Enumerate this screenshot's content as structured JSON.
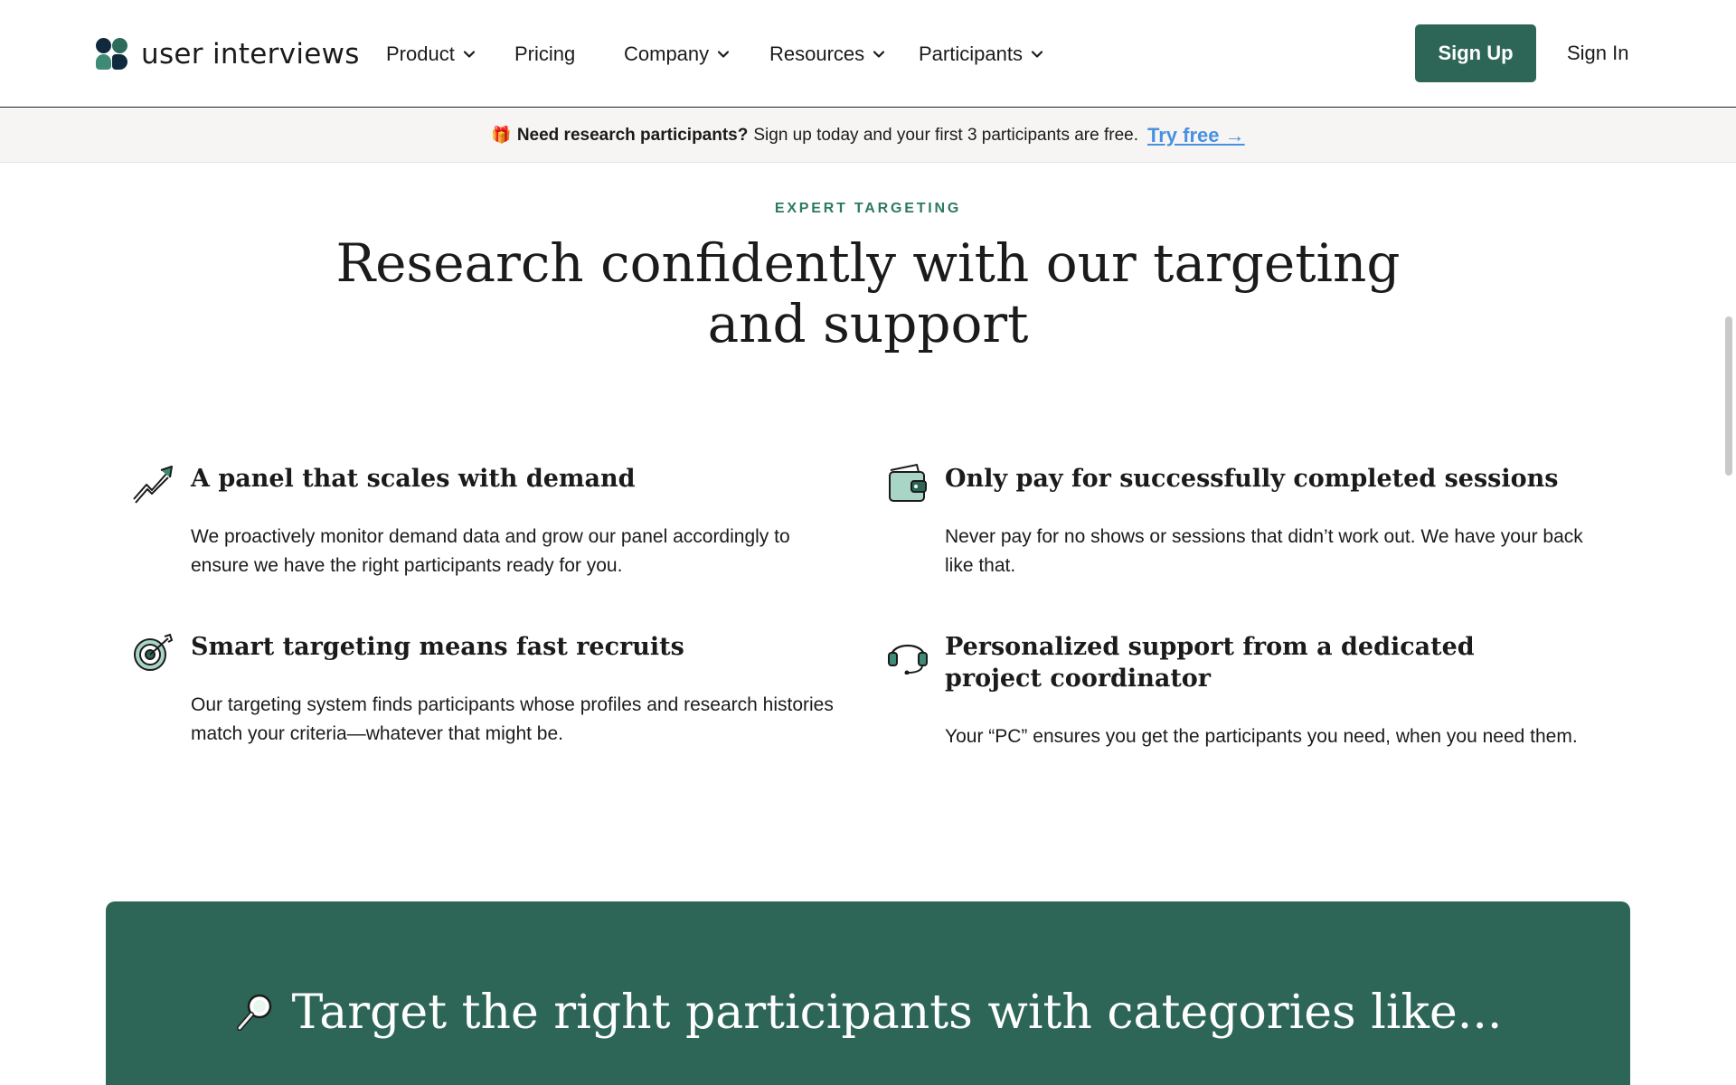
{
  "header": {
    "logo_text": "user interviews",
    "nav": [
      {
        "label": "Product",
        "dropdown": true
      },
      {
        "label": "Pricing",
        "dropdown": false
      },
      {
        "label": "Company",
        "dropdown": true
      },
      {
        "label": "Resources",
        "dropdown": true
      },
      {
        "label": "Participants",
        "dropdown": true
      }
    ],
    "signup_label": "Sign Up",
    "signin_label": "Sign In"
  },
  "banner": {
    "gift_icon": "🎁",
    "bold_text": "Need research participants?",
    "text": "Sign up today and your first 3 participants are free.",
    "cta_label": "Try free →"
  },
  "section": {
    "eyebrow": "EXPERT TARGETING",
    "headline": "Research confidently with our targeting and support"
  },
  "features": [
    {
      "icon": "trending-up-arrow-icon",
      "title": "A panel that scales with demand",
      "body": "We proactively monitor demand data and grow our panel accordingly to ensure we have the right participants ready for you."
    },
    {
      "icon": "wallet-icon",
      "title": "Only pay for successfully completed sessions",
      "body": "Never pay for no shows or sessions that didn’t work out. We have your back like that."
    },
    {
      "icon": "target-icon",
      "title": "Smart targeting means fast recruits",
      "body": "Our targeting system finds participants whose profiles and research histories match your criteria—whatever that might be."
    },
    {
      "icon": "headset-icon",
      "title": "Personalized support from a dedicated project coordinator",
      "body": "Your “PC” ensures you get the participants you need, when you need them."
    }
  ],
  "cta_panel": {
    "icon": "magnifying-glass-icon",
    "title": "Target the right participants with categories like..."
  },
  "colors": {
    "brand_green": "#2d6656",
    "eyebrow_green": "#2d7a5f",
    "link_blue": "#4a90e2",
    "banner_bg": "#f7f5f3"
  }
}
